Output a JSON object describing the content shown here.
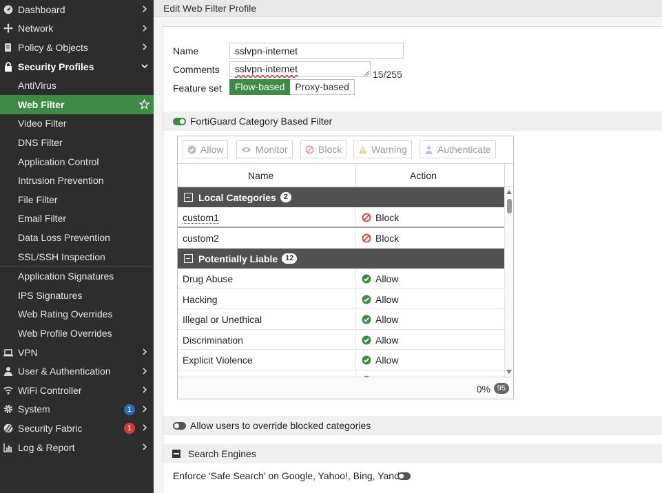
{
  "sidebar": {
    "items": [
      {
        "label": "Dashboard",
        "icon": "dashboard-icon"
      },
      {
        "label": "Network",
        "icon": "network-icon"
      },
      {
        "label": "Policy & Objects",
        "icon": "policy-icon"
      },
      {
        "label": "Security Profiles",
        "icon": "lock-icon"
      },
      {
        "label": "AntiVirus"
      },
      {
        "label": "Web Filter"
      },
      {
        "label": "Video Filter"
      },
      {
        "label": "DNS Filter"
      },
      {
        "label": "Application Control"
      },
      {
        "label": "Intrusion Prevention"
      },
      {
        "label": "File Filter"
      },
      {
        "label": "Email Filter"
      },
      {
        "label": "Data Loss Prevention"
      },
      {
        "label": "SSL/SSH Inspection"
      },
      {
        "label": "Application Signatures"
      },
      {
        "label": "IPS Signatures"
      },
      {
        "label": "Web Rating Overrides"
      },
      {
        "label": "Web Profile Overrides"
      },
      {
        "label": "VPN",
        "icon": "laptop-icon"
      },
      {
        "label": "User & Authentication",
        "icon": "user-icon"
      },
      {
        "label": "WiFi Controller",
        "icon": "wifi-icon"
      },
      {
        "label": "System",
        "icon": "gear-icon",
        "badge": "1"
      },
      {
        "label": "Security Fabric",
        "icon": "fabric-icon",
        "badge": "1"
      },
      {
        "label": "Log & Report",
        "icon": "chart-icon"
      }
    ]
  },
  "header": {
    "title": "Edit Web Filter Profile"
  },
  "form": {
    "name_label": "Name",
    "name_value": "sslvpn-internet",
    "comments_label": "Comments",
    "comments_value": "sslvpn-internet",
    "comments_count": "15/255",
    "feature_set_label": "Feature set",
    "feature_set_options": [
      "Flow-based",
      "Proxy-based"
    ],
    "feature_set_selected": "Flow-based"
  },
  "fortiguard": {
    "label": "FortiGuard Category Based Filter",
    "enabled": true,
    "actions": [
      "Allow",
      "Monitor",
      "Block",
      "Warning",
      "Authenticate"
    ],
    "columns": [
      "Name",
      "Action"
    ],
    "groups": [
      {
        "name": "Local Categories",
        "count": "2",
        "rows": [
          {
            "name": "custom1",
            "action": "Block"
          },
          {
            "name": "custom2",
            "action": "Block"
          }
        ]
      },
      {
        "name": "Potentially Liable",
        "count": "12",
        "rows": [
          {
            "name": "Drug Abuse",
            "action": "Allow"
          },
          {
            "name": "Hacking",
            "action": "Allow"
          },
          {
            "name": "Illegal or Unethical",
            "action": "Allow"
          },
          {
            "name": "Discrimination",
            "action": "Allow"
          },
          {
            "name": "Explicit Violence",
            "action": "Allow"
          }
        ]
      }
    ],
    "footer_progress": "0%",
    "footer_total": "95"
  },
  "override": {
    "label": "Allow users to override blocked categories",
    "enabled": false
  },
  "search_engines": {
    "label": "Search Engines",
    "safe_search_label": "Enforce 'Safe Search' on Google, Yahoo!, Bing, Yandex",
    "safe_search_enabled": false
  },
  "colors": {
    "accent": "#3f8b45",
    "sidebar_bg": "#2d2d2d",
    "block_red": "#d43b34",
    "badge_blue": "#2a6db8"
  }
}
